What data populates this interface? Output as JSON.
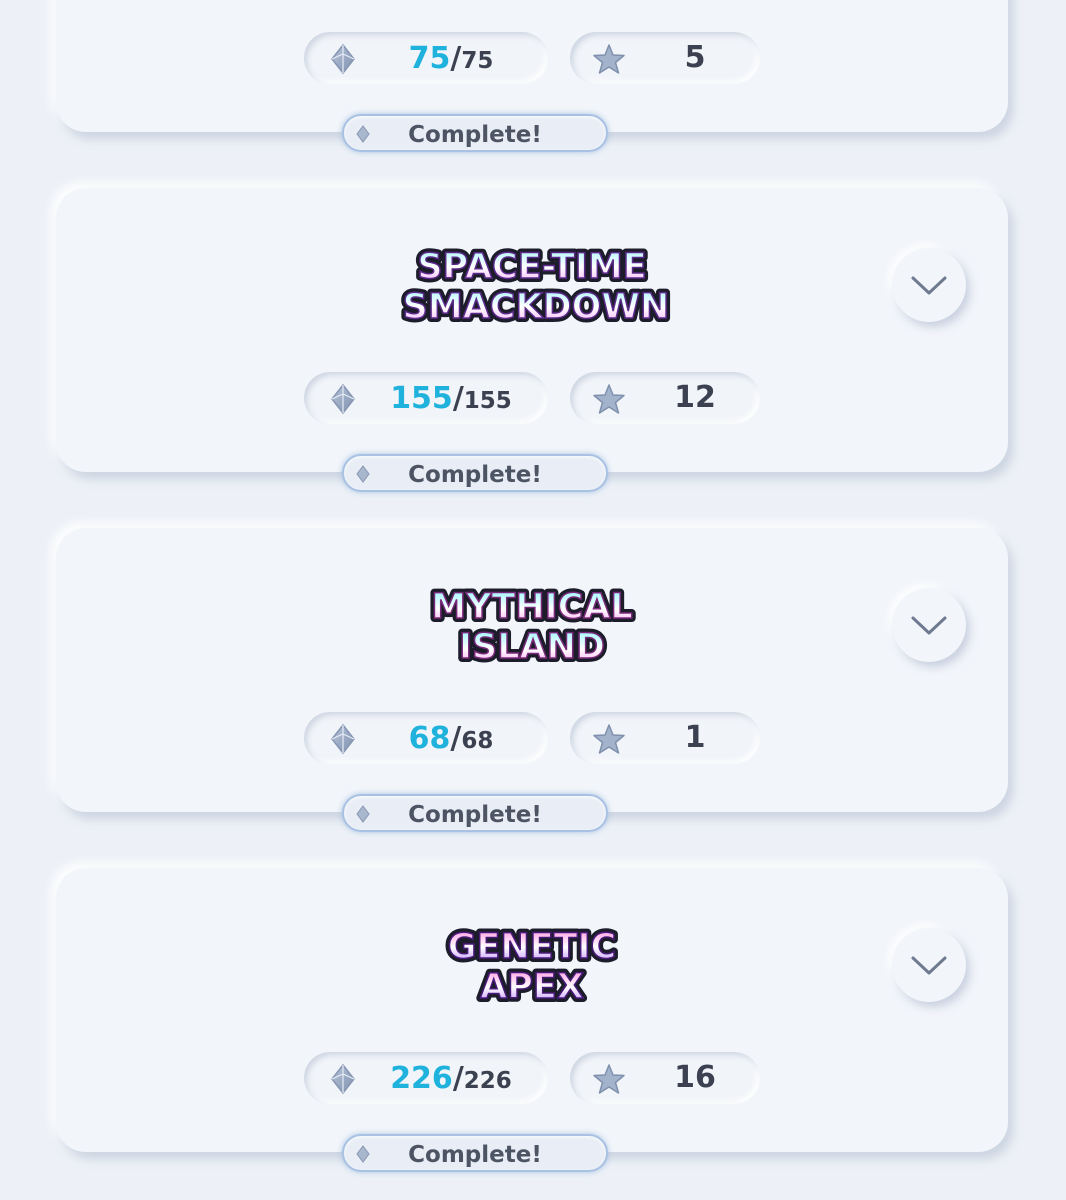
{
  "sets": [
    {
      "logo_lines": [],
      "cards_have": "75",
      "cards_total": "75",
      "stars": "5",
      "status": "Complete!"
    },
    {
      "logo_lines": [
        "SPACE-TIME",
        "SMACKDOWN"
      ],
      "cards_have": "155",
      "cards_total": "155",
      "stars": "12",
      "status": "Complete!"
    },
    {
      "logo_lines": [
        "MYTHICAL",
        "ISLAND"
      ],
      "cards_have": "68",
      "cards_total": "68",
      "stars": "1",
      "status": "Complete!"
    },
    {
      "logo_lines": [
        "GENETIC",
        "APEX"
      ],
      "cards_have": "226",
      "cards_total": "226",
      "stars": "16",
      "status": "Complete!"
    }
  ],
  "icons": {
    "cards": "diamond-icon",
    "stars": "star-icon",
    "expand": "chevron-down-icon",
    "badge": "diamond-icon"
  },
  "colors": {
    "collected_count": "#1fb2dc",
    "text": "#3b4150",
    "badge_border": "#a9c2e3"
  }
}
